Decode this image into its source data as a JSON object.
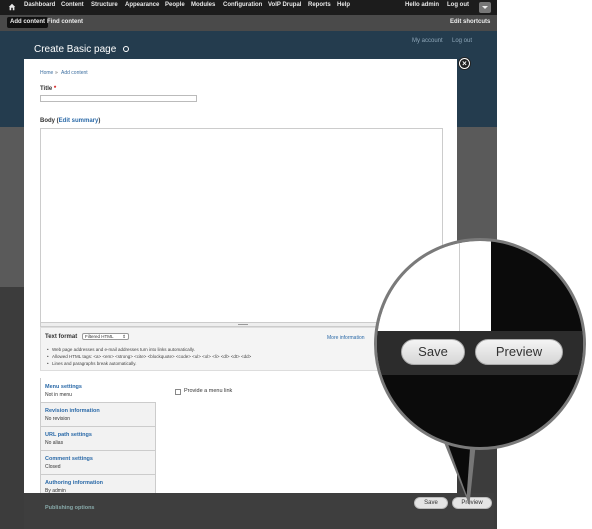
{
  "toolbar": {
    "items": [
      "Dashboard",
      "Content",
      "Structure",
      "Appearance",
      "People",
      "Modules",
      "Configuration",
      "VoIP Drupal",
      "Reports",
      "Help"
    ],
    "user_greeting": "Hello admin",
    "logout": "Log out"
  },
  "shortcuts": {
    "add_content": "Add content",
    "find_content": "Find content",
    "edit_shortcuts": "Edit shortcuts"
  },
  "header": {
    "title": "Create Basic page",
    "my_account": "My account",
    "log_out": "Log out"
  },
  "breadcrumb": {
    "home": "Home",
    "separator": "»",
    "current": "Add content"
  },
  "form": {
    "title_label": "Title",
    "required_mark": "*",
    "body_label": "Body",
    "edit_summary": "Edit summary",
    "text_format_label": "Text format",
    "text_format_value": "Filtered HTML",
    "more_information": "More information",
    "tips": [
      "Web page addresses and e-mail addresses turn into links automatically.",
      "Allowed HTML tags: <a> <em> <strong> <cite> <blockquote> <code> <ul> <ol> <li> <dl> <dt> <dd>",
      "Lines and paragraphs break automatically."
    ]
  },
  "vertical_tabs": [
    {
      "title": "Menu settings",
      "summary": "Not in menu"
    },
    {
      "title": "Revision information",
      "summary": "No revision"
    },
    {
      "title": "URL path settings",
      "summary": "No alias"
    },
    {
      "title": "Comment settings",
      "summary": "Closed"
    },
    {
      "title": "Authoring information",
      "summary": "By admin"
    },
    {
      "title": "Publishing options",
      "summary": ""
    }
  ],
  "menu_pane": {
    "checkbox_label": "Provide a menu link"
  },
  "actions": {
    "save": "Save",
    "preview": "Preview"
  },
  "colors": {
    "toolbar": "#1c1c1c",
    "link": "#2b6aa8",
    "header": "#243c4e"
  }
}
